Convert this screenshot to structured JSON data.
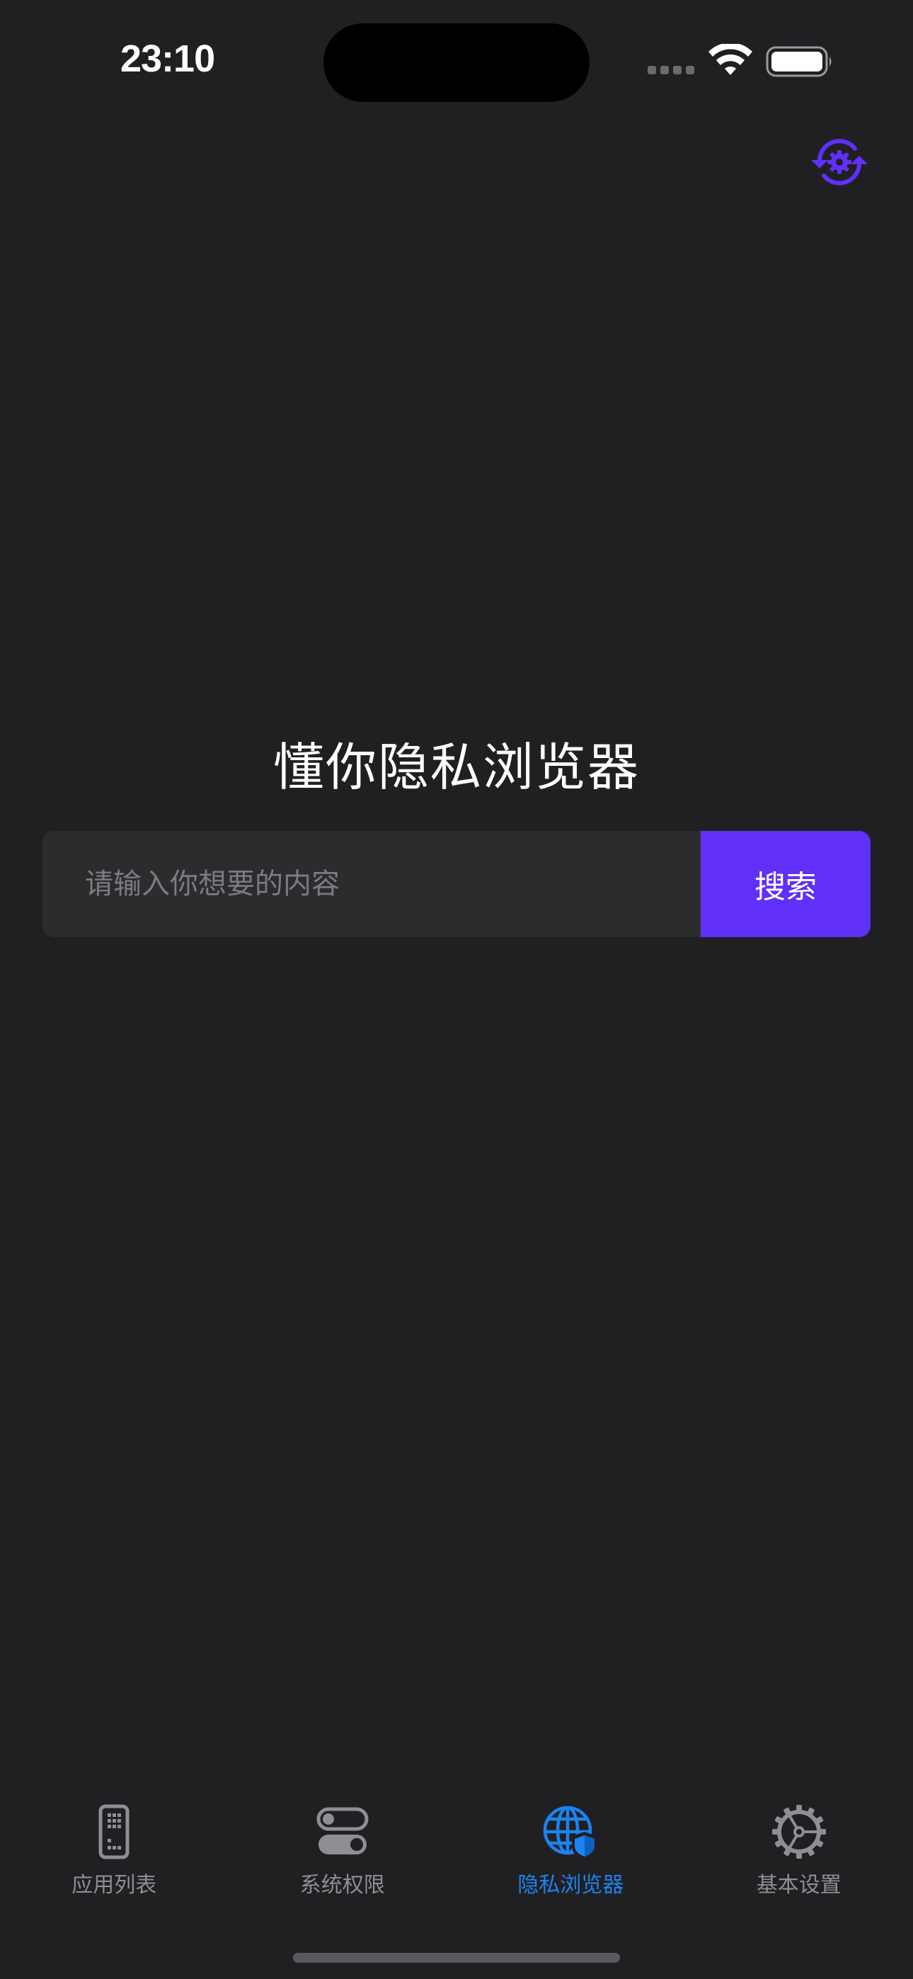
{
  "status_bar": {
    "time": "23:10",
    "icons": [
      "signal-dots-icon",
      "wifi-icon",
      "battery-icon"
    ]
  },
  "header": {
    "action_icon": "sync-settings-icon",
    "accent_color": "#6030f8"
  },
  "main": {
    "title": "懂你隐私浏览器",
    "search": {
      "placeholder": "请输入你想要的内容",
      "value": "",
      "button_label": "搜索"
    }
  },
  "tab_bar": {
    "active_color": "#1b83f2",
    "inactive_color": "#8e8e93",
    "tabs": [
      {
        "label": "应用列表",
        "icon": "phone-grid-icon",
        "active": false
      },
      {
        "label": "系统权限",
        "icon": "toggles-icon",
        "active": false
      },
      {
        "label": "隐私浏览器",
        "icon": "globe-shield-icon",
        "active": true
      },
      {
        "label": "基本设置",
        "icon": "gear-icon",
        "active": false
      }
    ]
  }
}
